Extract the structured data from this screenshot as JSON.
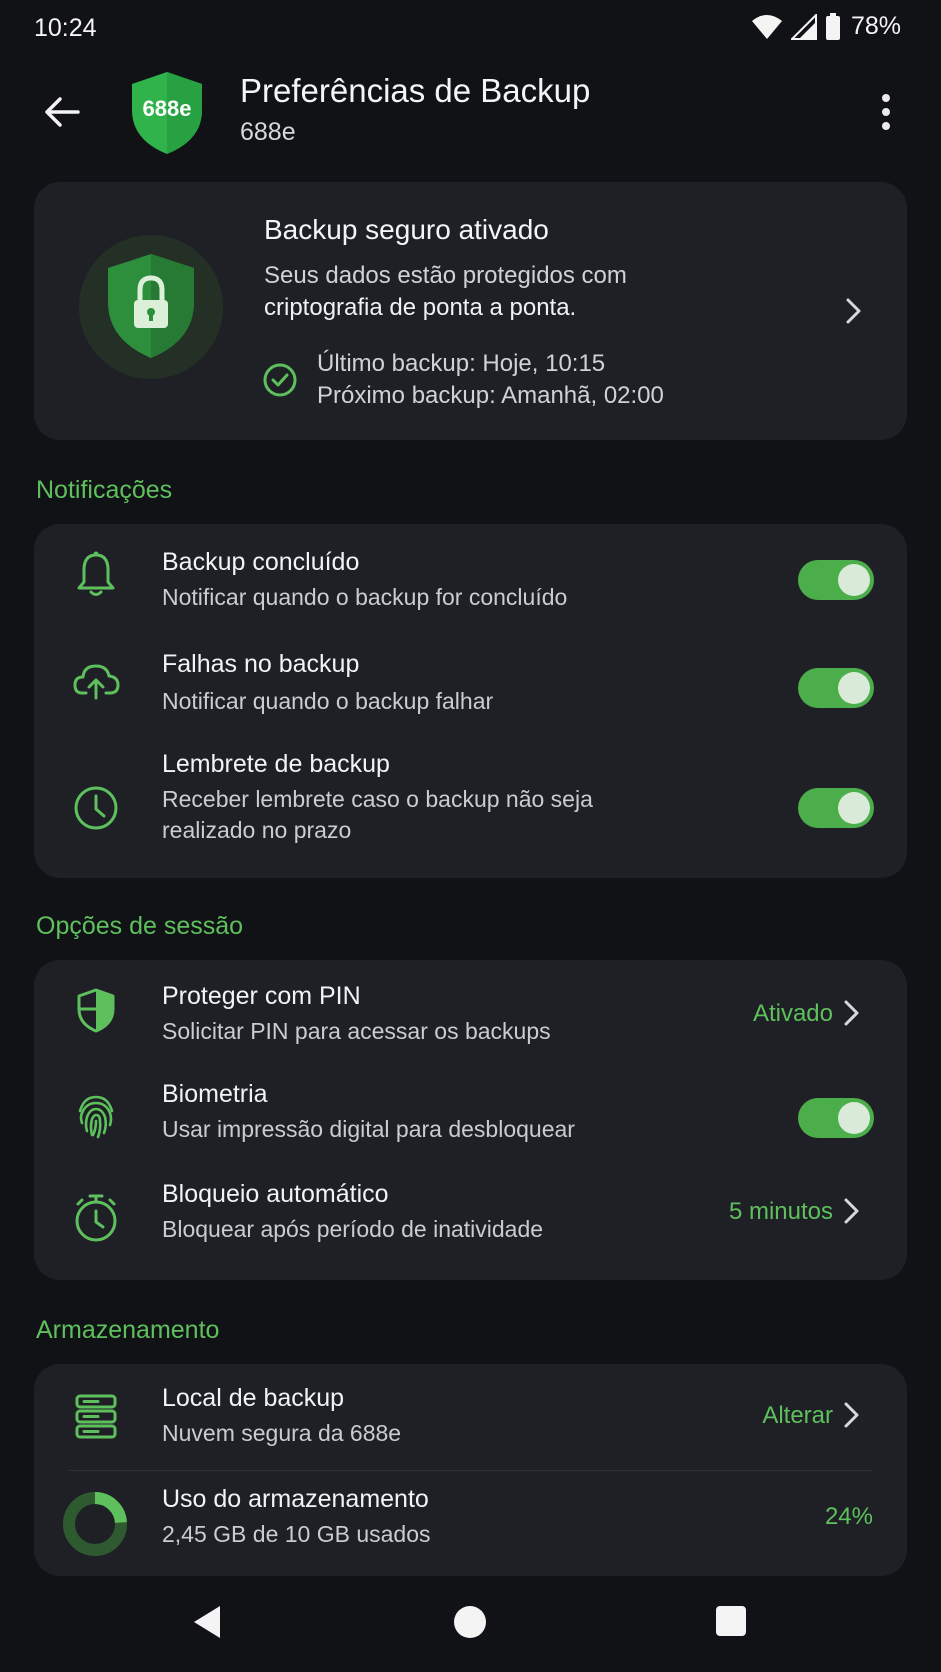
{
  "status_bar": {
    "time": "10:24",
    "battery": "78%",
    "icons": [
      "wifi-icon",
      "signal-icon",
      "battery-icon"
    ]
  },
  "app_bar": {
    "logo_text": "688e",
    "title": "Preferências de Backup",
    "subtitle": "688e",
    "back_icon": "arrow-left-icon",
    "more_icon": "more-vert-icon"
  },
  "hero": {
    "title": "Backup seguro ativado",
    "desc_line1": "Seus dados estão protegidos com",
    "desc_line2": "criptografia de ponta a ponta.",
    "last_backup": "Último backup: Hoje, 10:15",
    "next_backup": "Próximo backup: Amanhã, 02:00",
    "icon": "shield-lock-icon"
  },
  "notifications": {
    "section_title": "Notificações",
    "items": [
      {
        "title": "Backup concluído",
        "subtitle": "Notificar quando o backup for concluído",
        "icon": "bell-icon",
        "enabled": true
      },
      {
        "title": "Falhas no backup",
        "subtitle": "Notificar quando o backup falhar",
        "icon": "cloud-upload-icon",
        "enabled": true
      },
      {
        "title": "Lembrete de backup",
        "subtitle": "Receber lembrete caso o backup não seja realizado no prazo",
        "icon": "clock-icon",
        "enabled": true
      }
    ]
  },
  "session": {
    "section_title": "Opções de sessão",
    "items": [
      {
        "title": "Proteger com PIN",
        "subtitle": "Solicitar PIN para acessar os backups",
        "value": "Ativado",
        "icon": "shield-half-icon"
      },
      {
        "title": "Biometria",
        "subtitle": "Usar impressão digital para desbloquear",
        "icon": "fingerprint-icon",
        "enabled": true
      },
      {
        "title": "Bloqueio automático",
        "subtitle": "Bloquear após período de inatividade",
        "value": "5 minutos",
        "icon": "timer-icon"
      }
    ]
  },
  "storage": {
    "section_title": "Armazenamento",
    "location": {
      "title": "Local de backup",
      "subtitle": "Nuvem segura da 688e",
      "value": "Alterar",
      "icon": "server-icon"
    },
    "usage": {
      "title": "Uso do armazenamento",
      "subtitle": "2,45 GB de 10 GB usados",
      "value": "24%",
      "fraction": 0.24,
      "icon": "donut-chart-icon"
    }
  },
  "colors": {
    "accent": "#5ec05c",
    "toggle_track": "#4cae4a",
    "card_bg": "#1e2026",
    "page_bg": "#111216"
  },
  "nav_bar": {
    "icons": [
      "nav-back-icon",
      "nav-home-icon",
      "nav-recents-icon"
    ]
  }
}
